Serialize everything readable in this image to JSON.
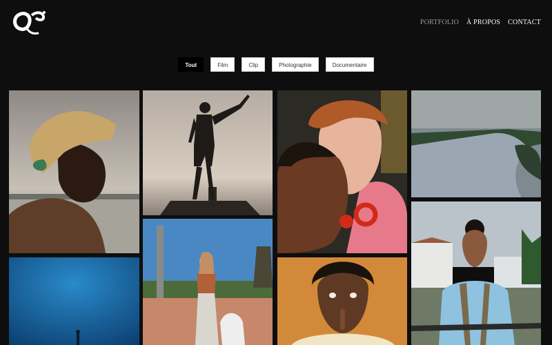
{
  "header": {
    "logo_text": "Q",
    "nav": [
      {
        "label": "PORTFOLIO",
        "active": true
      },
      {
        "label": "À PROPOS",
        "active": false
      },
      {
        "label": "CONTACT",
        "active": false
      }
    ]
  },
  "filters": [
    {
      "label": "Tout",
      "active": true
    },
    {
      "label": "Film",
      "active": false
    },
    {
      "label": "Clip",
      "active": false
    },
    {
      "label": "Photographie",
      "active": false
    },
    {
      "label": "Documentaire",
      "active": false
    }
  ],
  "colors": {
    "background": "#0e0e0e",
    "nav_active": "#9a9a9a",
    "filter_active_bg": "#000000"
  },
  "gallery": [
    {
      "name": "portrait-safari-hat"
    },
    {
      "name": "silhouette-pointing"
    },
    {
      "name": "couple-embrace"
    },
    {
      "name": "aerial-river"
    },
    {
      "name": "underwater-diver"
    },
    {
      "name": "woman-with-dog"
    },
    {
      "name": "shh-portrait"
    },
    {
      "name": "young-man-bicycle"
    }
  ]
}
